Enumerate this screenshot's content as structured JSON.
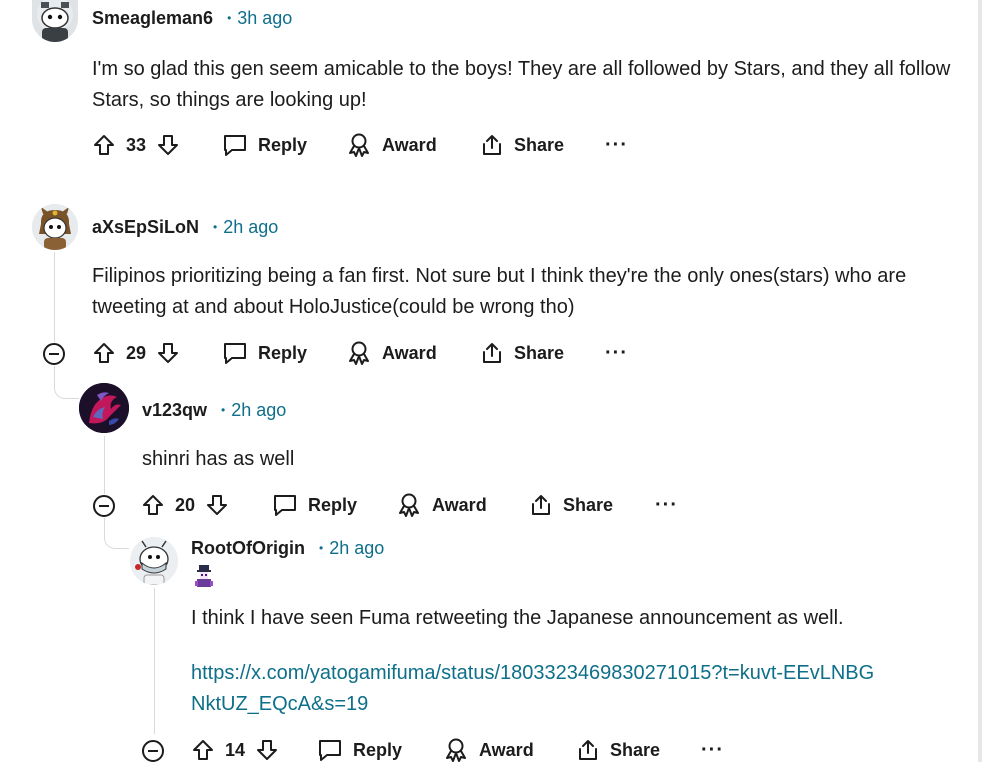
{
  "comments": [
    {
      "username": "Smeagleman6",
      "time": "3h ago",
      "body": "I'm so glad this gen seem amicable to the boys! They are all followed by Stars, and they all follow Stars, so things are looking up!",
      "votes": "33"
    },
    {
      "username": "aXsEpSiLoN",
      "time": "2h ago",
      "body": "Filipinos prioritizing being a fan first. Not sure but I think they're the only ones(stars) who are tweeting at and about HoloJustice(could be wrong tho)",
      "votes": "29"
    },
    {
      "username": "v123qw",
      "time": "2h ago",
      "body": "shinri has as well",
      "votes": "20"
    },
    {
      "username": "RootOfOrigin",
      "time": "2h ago",
      "body": "I think I have seen Fuma retweeting the Japanese announcement as well.",
      "link": "https://x.com/yatogamifuma/status/1803323469830271015?t=kuvt-EEvLNBGNktUZ_EQcA&s=19",
      "votes": "14"
    }
  ],
  "actions": {
    "reply": "Reply",
    "award": "Award",
    "share": "Share",
    "more": "···",
    "dot": "•"
  },
  "icons": {
    "upvote": "arrow-up-outline",
    "downvote": "arrow-down-outline",
    "reply": "speech-bubble",
    "award": "ribbon-medal",
    "share": "share-box-arrow",
    "collapse": "circle-minus"
  },
  "colors": {
    "time_accent": "#0e6f8a",
    "text": "#1c1c1c",
    "thread_line": "#d7dadc"
  }
}
